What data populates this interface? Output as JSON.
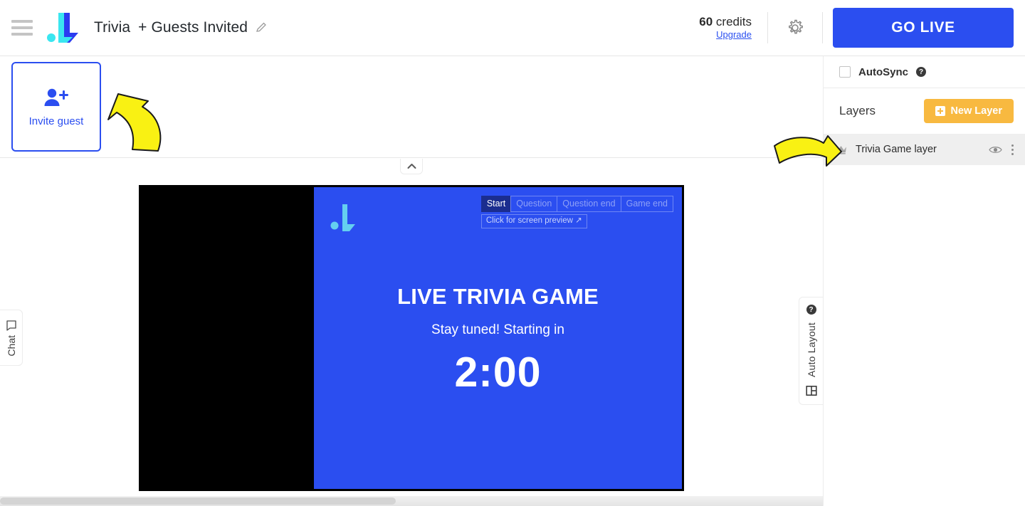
{
  "topbar": {
    "menu_icon": "hamburger-menu-icon",
    "logo_icon": "brand-logo-icon",
    "title": "Trivia",
    "title_suffix": "+ Guests Invited",
    "edit_icon": "pencil-edit-icon",
    "credits_value": "60",
    "credits_label": "credits",
    "upgrade_label": "Upgrade",
    "settings_icon": "gear-icon",
    "go_live_label": "GO LIVE",
    "go_live_color": "#2b4ef0"
  },
  "stage": {
    "invite": {
      "icon": "add-person-icon",
      "label": "Invite guest",
      "accent_color": "#2b4ef0"
    },
    "collapse_icon": "chevron-up-icon",
    "chat_tab": {
      "label": "Chat",
      "icon": "chat-bubble-icon"
    },
    "auto_layout_tab": {
      "label": "Auto Layout",
      "help_icon": "question-mark-icon",
      "layout_icon": "layout-grid-icon"
    },
    "preview": {
      "tabs": [
        {
          "label": "Start",
          "active": true
        },
        {
          "label": "Question",
          "active": false
        },
        {
          "label": "Question end",
          "active": false
        },
        {
          "label": "Game end",
          "active": false
        }
      ],
      "hint": "Click for screen preview ↗",
      "watermark_icon": "brand-watermark-icon",
      "background_color": "#2b4ef0",
      "title": "LIVE TRIVIA GAME",
      "subtitle": "Stay tuned! Starting in",
      "timer": "2:00"
    }
  },
  "right_panel": {
    "autosync": {
      "label": "AutoSync",
      "checked": false,
      "help_icon": "question-mark-icon"
    },
    "layers": {
      "title": "Layers",
      "new_layer_label": "New Layer",
      "new_layer_icon": "plus-icon",
      "new_layer_color": "#f8b940",
      "items": [
        {
          "name": "Trivia Game layer",
          "badge_icon": "crown-icon",
          "visibility_icon": "eye-icon",
          "menu_icon": "kebab-menu-icon"
        }
      ]
    }
  },
  "annotations": {
    "arrow_invite": "yellow-arrow-pointing-to-invite-guest",
    "arrow_layers": "yellow-arrow-pointing-to-trivia-game-layer",
    "arrow_color": "#f9f113"
  }
}
